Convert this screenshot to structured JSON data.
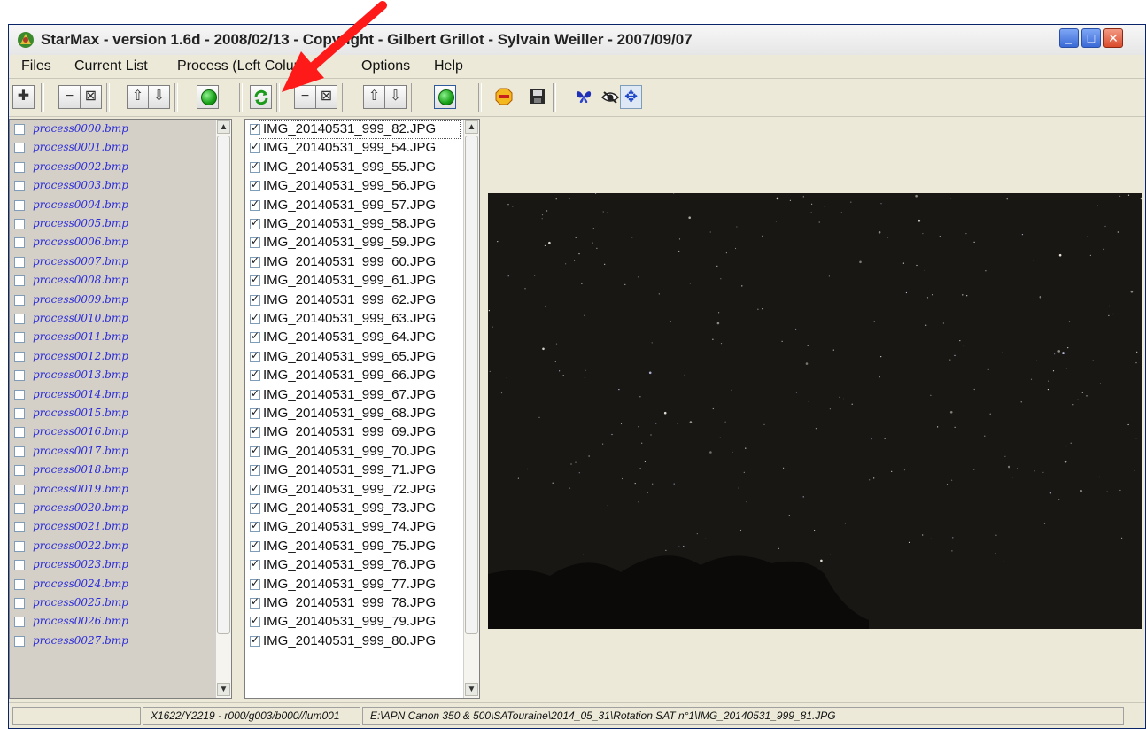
{
  "title": "StarMax - version 1.6d - 2008/02/13 - Copyright - Gilbert Grillot - Sylvain Weiller - 2007/09/07",
  "menu": [
    "Files",
    "Current List",
    "Process (Left Column)",
    "Options",
    "Help"
  ],
  "left_list": [
    "process0000.bmp",
    "process0001.bmp",
    "process0002.bmp",
    "process0003.bmp",
    "process0004.bmp",
    "process0005.bmp",
    "process0006.bmp",
    "process0007.bmp",
    "process0008.bmp",
    "process0009.bmp",
    "process0010.bmp",
    "process0011.bmp",
    "process0012.bmp",
    "process0013.bmp",
    "process0014.bmp",
    "process0015.bmp",
    "process0016.bmp",
    "process0017.bmp",
    "process0018.bmp",
    "process0019.bmp",
    "process0020.bmp",
    "process0021.bmp",
    "process0022.bmp",
    "process0023.bmp",
    "process0024.bmp",
    "process0025.bmp",
    "process0026.bmp",
    "process0027.bmp"
  ],
  "mid_list": [
    "IMG_20140531_999_82.JPG",
    "IMG_20140531_999_54.JPG",
    "IMG_20140531_999_55.JPG",
    "IMG_20140531_999_56.JPG",
    "IMG_20140531_999_57.JPG",
    "IMG_20140531_999_58.JPG",
    "IMG_20140531_999_59.JPG",
    "IMG_20140531_999_60.JPG",
    "IMG_20140531_999_61.JPG",
    "IMG_20140531_999_62.JPG",
    "IMG_20140531_999_63.JPG",
    "IMG_20140531_999_64.JPG",
    "IMG_20140531_999_65.JPG",
    "IMG_20140531_999_66.JPG",
    "IMG_20140531_999_67.JPG",
    "IMG_20140531_999_68.JPG",
    "IMG_20140531_999_69.JPG",
    "IMG_20140531_999_70.JPG",
    "IMG_20140531_999_71.JPG",
    "IMG_20140531_999_72.JPG",
    "IMG_20140531_999_73.JPG",
    "IMG_20140531_999_74.JPG",
    "IMG_20140531_999_75.JPG",
    "IMG_20140531_999_76.JPG",
    "IMG_20140531_999_77.JPG",
    "IMG_20140531_999_78.JPG",
    "IMG_20140531_999_79.JPG",
    "IMG_20140531_999_80.JPG"
  ],
  "status": {
    "pixel": "X1622/Y2219 - r000/g003/b000//lum001",
    "path": "E:\\APN Canon 350 & 500\\SATouraine\\2014_05_31\\Rotation SAT n°1\\IMG_20140531_999_81.JPG"
  },
  "colors": {
    "accent_arrow": "#ff1a1a",
    "list_text_left": "#2b2bd8"
  },
  "icons": [
    "plus-icon",
    "minus-icon",
    "clear-icon",
    "up-arrow-icon",
    "down-arrow-icon",
    "go-icon",
    "refresh-icon",
    "stop-icon",
    "save-icon",
    "butterfly-icon",
    "eye-icon",
    "move-icon"
  ]
}
